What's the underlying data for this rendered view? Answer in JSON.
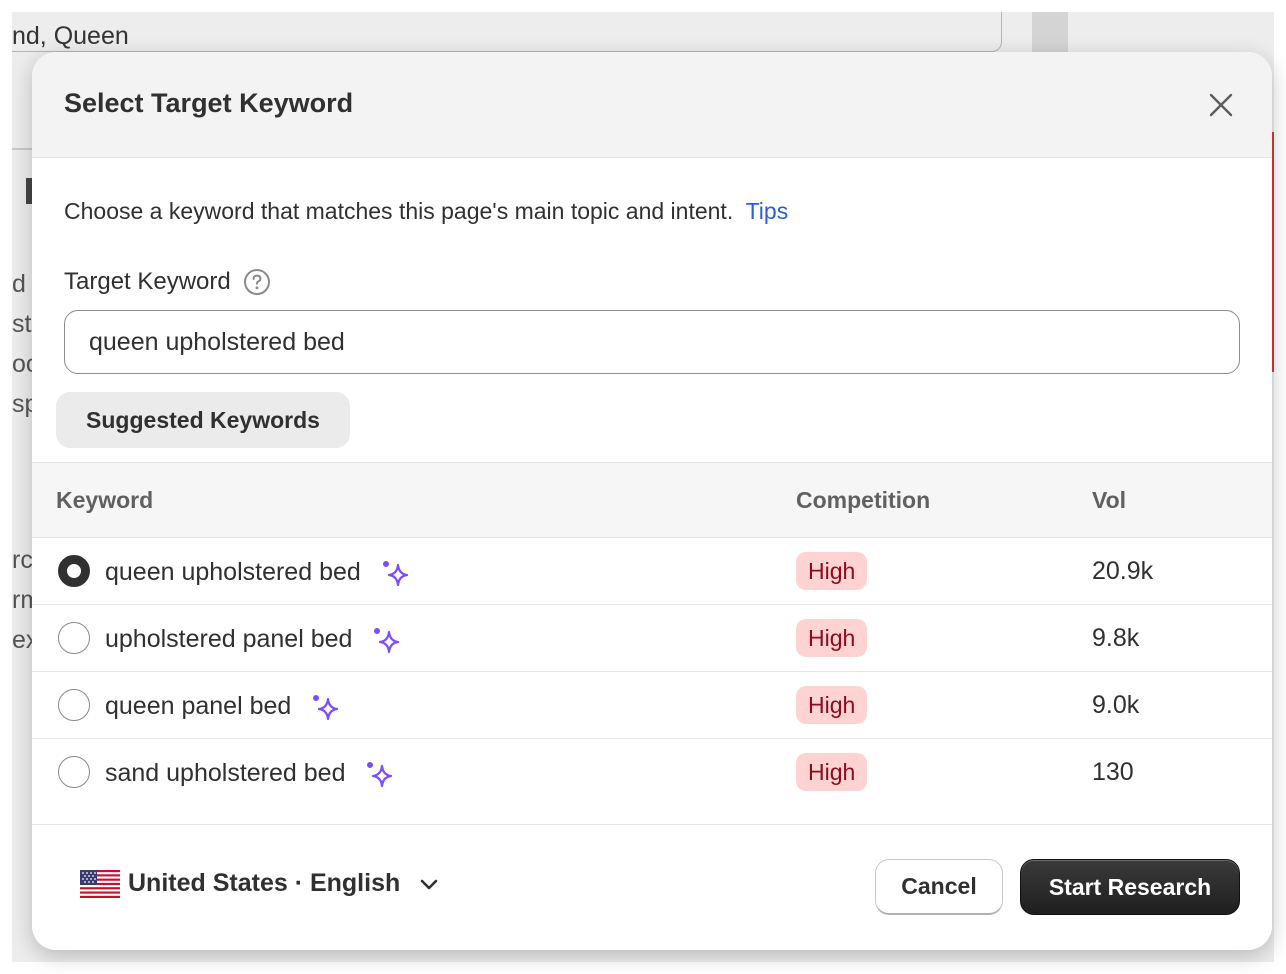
{
  "background": {
    "field_text": "nd, Queen",
    "fragments": [
      "d i",
      "st",
      "oo",
      "sp",
      "rc",
      "rm",
      "ex"
    ]
  },
  "modal": {
    "title": "Select Target Keyword",
    "description": "Choose a keyword that matches this page's main topic and intent.",
    "tips_label": "Tips",
    "field_label": "Target Keyword",
    "input_value": "queen upholstered bed",
    "suggested_label": "Suggested Keywords",
    "table": {
      "headers": [
        "Keyword",
        "Competition",
        "Vol"
      ],
      "rows": [
        {
          "keyword": "queen upholstered bed",
          "competition": "High",
          "vol": "20.9k",
          "selected": true
        },
        {
          "keyword": "upholstered panel bed",
          "competition": "High",
          "vol": "9.8k",
          "selected": false
        },
        {
          "keyword": "queen panel bed",
          "competition": "High",
          "vol": "9.0k",
          "selected": false
        },
        {
          "keyword": "sand upholstered bed",
          "competition": "High",
          "vol": "130",
          "selected": false
        }
      ]
    },
    "footer": {
      "locale_label": "United States · English",
      "cancel_label": "Cancel",
      "start_label": "Start Research"
    }
  },
  "icons": {
    "close": "close-icon",
    "help": "question-circle-icon",
    "sparkle": "ai-sparkle-icon",
    "flag": "us-flag-icon",
    "chevron": "chevron-down-icon"
  },
  "colors": {
    "accent_link": "#2b5fd9",
    "sparkle": "#7b4dff",
    "badge_bg": "#fed3d1",
    "badge_text": "#8e0b21",
    "primary_button": "#2a2a2a"
  }
}
